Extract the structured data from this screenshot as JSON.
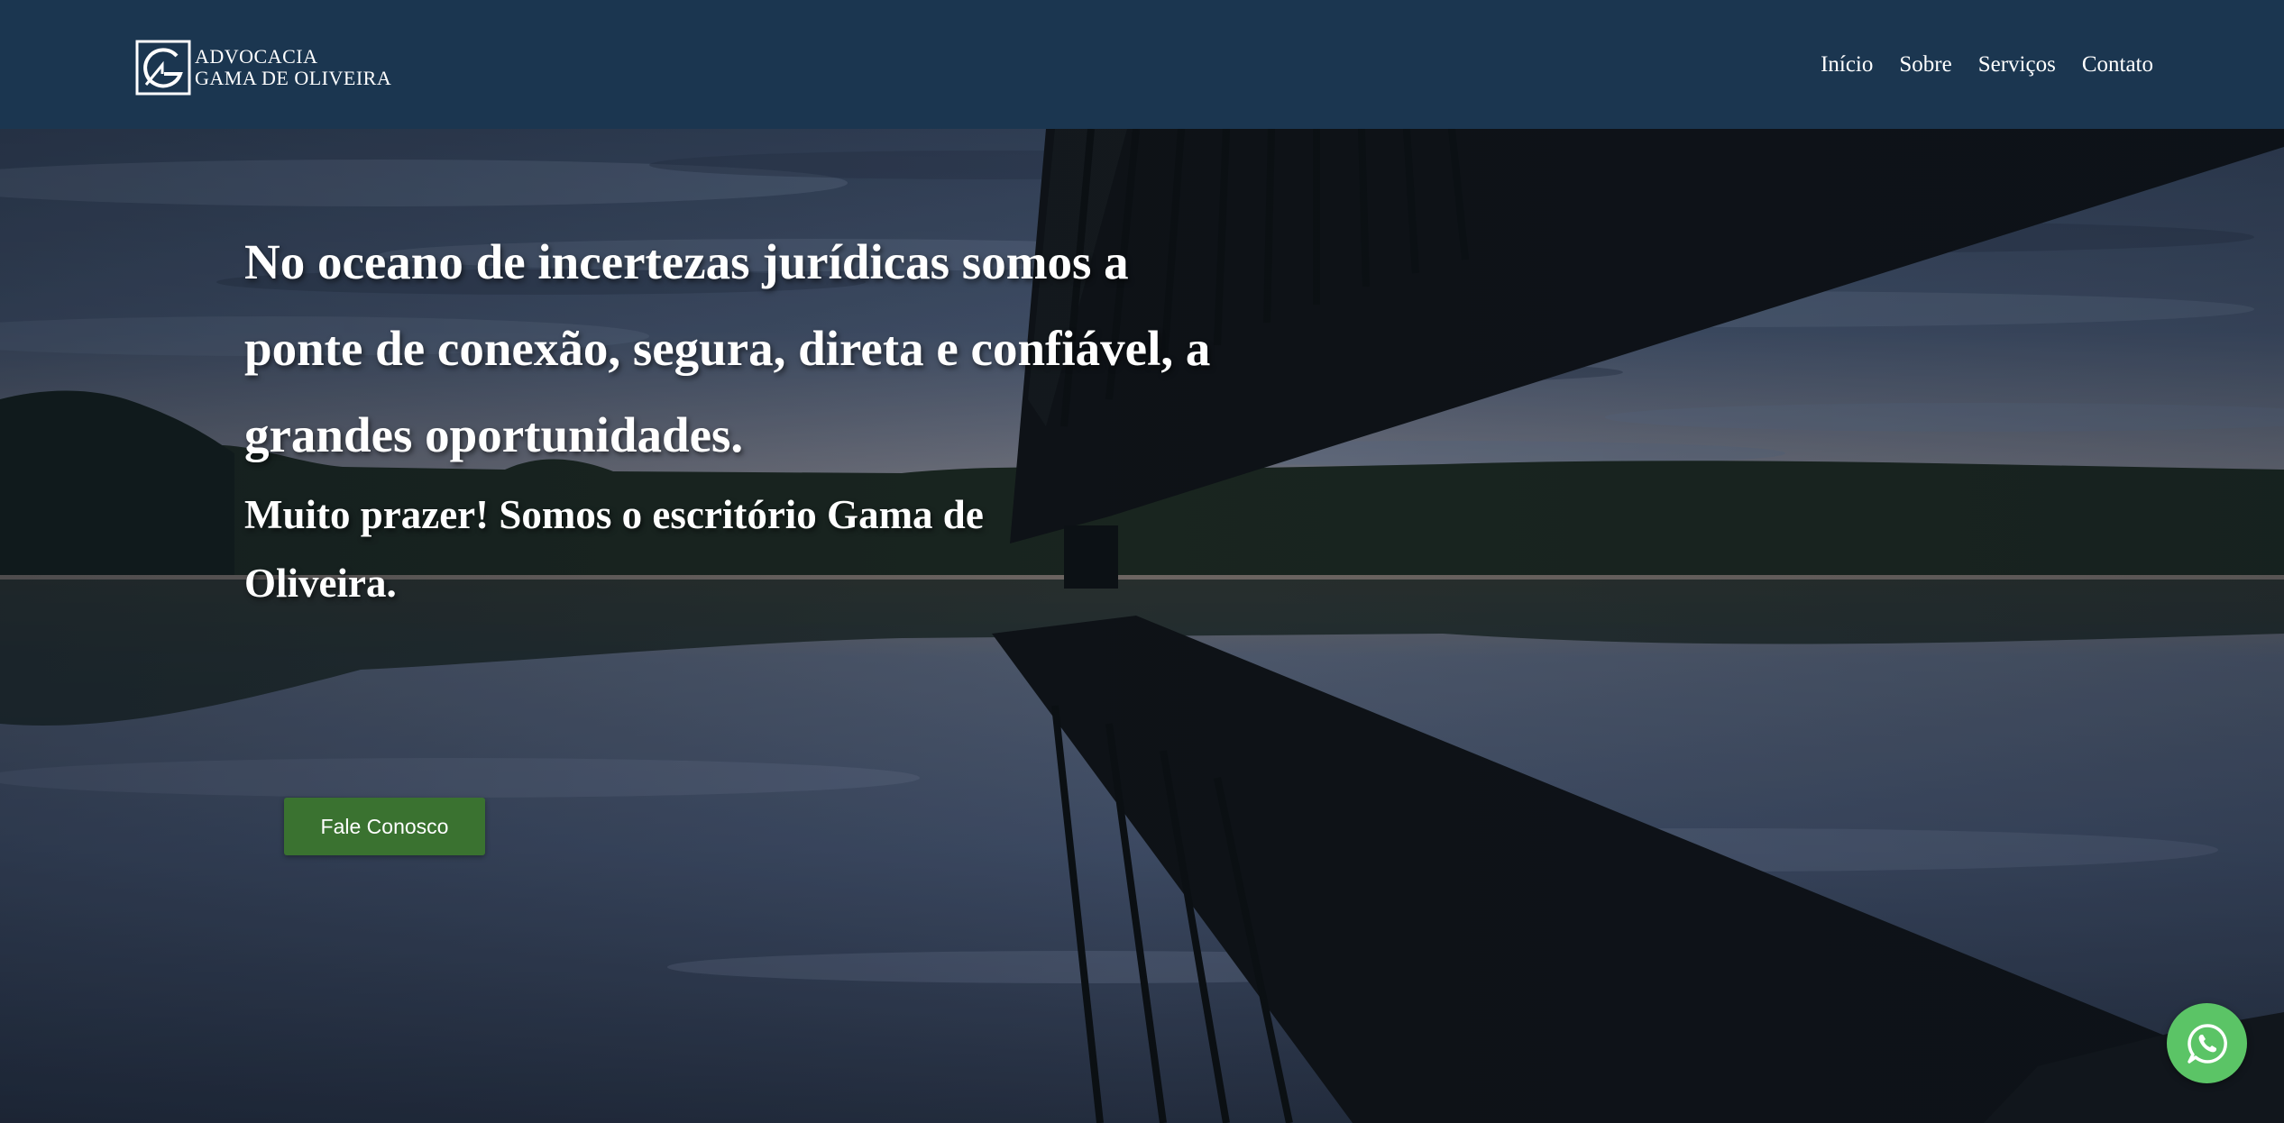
{
  "brand": {
    "line1": "ADVOCACIA",
    "line2": "GAMA DE OLIVEIRA"
  },
  "nav": {
    "items": [
      {
        "label": "Início"
      },
      {
        "label": "Sobre"
      },
      {
        "label": "Serviços"
      },
      {
        "label": "Contato"
      }
    ]
  },
  "hero": {
    "title": "No oceano de incertezas jurídicas somos a ponte de conexão, segura, direta e confiável, a grandes oportunidades.",
    "subtitle": "Muito prazer! Somos o escritório Gama de Oliveira.",
    "cta_label": "Fale Conosco"
  },
  "floating": {
    "whatsapp_icon": "whatsapp-icon"
  },
  "colors": {
    "header_bg": "#1b3650",
    "cta_bg": "#3a7230",
    "whatsapp_bg": "#5bc466",
    "text": "#ffffff"
  }
}
